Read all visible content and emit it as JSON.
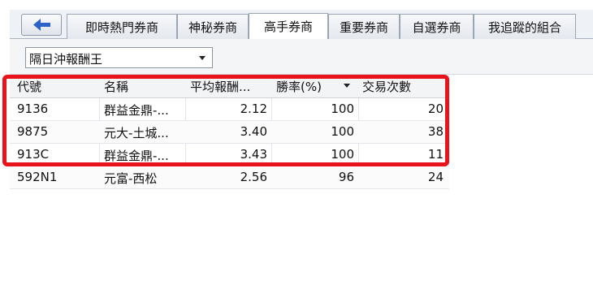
{
  "tabs": [
    "即時熱門券商",
    "神秘券商",
    "高手券商",
    "重要券商",
    "自選券商",
    "我追蹤的組合"
  ],
  "active_tab": 2,
  "combo": {
    "value": "隔日沖報酬王"
  },
  "table": {
    "columns": [
      "代號",
      "名稱",
      "平均報酬...",
      "勝率(%)",
      "交易次數"
    ],
    "rows": [
      [
        "9136",
        "群益金鼎-...",
        "2.12",
        "100",
        "20"
      ],
      [
        "9875",
        "元大-土城...",
        "3.40",
        "100",
        "38"
      ],
      [
        "913C",
        "群益金鼎-...",
        "3.43",
        "100",
        "11"
      ],
      [
        "592N1",
        "元富-西松",
        "2.56",
        "96",
        "24"
      ]
    ]
  },
  "colors": {
    "highlight": "#e8131b",
    "back_arrow": "#2d63c8"
  }
}
